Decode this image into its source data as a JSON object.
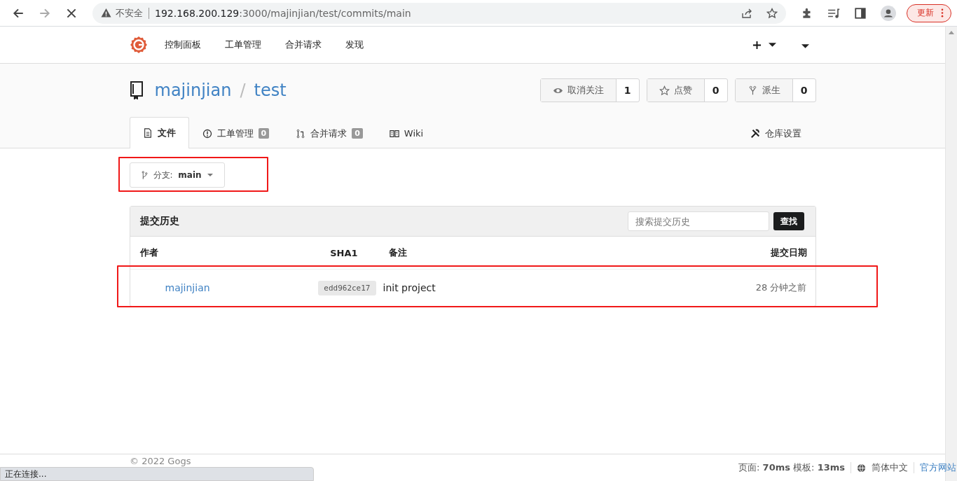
{
  "browser": {
    "security": "不安全",
    "url_host": "192.168.200.129",
    "url_path": ":3000/majinjian/test/commits/main",
    "update_button": "更新"
  },
  "nav": {
    "items": [
      "控制面板",
      "工单管理",
      "合并请求",
      "发现"
    ]
  },
  "repo": {
    "owner": "majinjian",
    "separator": "/",
    "name": "test",
    "actions": [
      {
        "label": "取消关注",
        "count": "1",
        "kind": "watch"
      },
      {
        "label": "点赞",
        "count": "0",
        "kind": "star"
      },
      {
        "label": "派生",
        "count": "0",
        "kind": "fork"
      }
    ]
  },
  "tabs": [
    {
      "label": "文件",
      "selected": true,
      "kind": "file"
    },
    {
      "label": "工单管理",
      "badge": "0",
      "selected": false,
      "kind": "issue"
    },
    {
      "label": "合并请求",
      "badge": "0",
      "selected": false,
      "kind": "pull"
    },
    {
      "label": "Wiki",
      "selected": false,
      "kind": "wiki"
    }
  ],
  "settings_tab": "仓库设置",
  "branch": {
    "label": "分支:",
    "value": "main"
  },
  "commits": {
    "title": "提交历史",
    "search_placeholder": "搜索提交历史",
    "search_button": "查找",
    "columns": [
      "作者",
      "SHA1",
      "备注",
      "提交日期"
    ],
    "rows": [
      {
        "author": "majinjian",
        "sha": "edd962ce17",
        "message": "init project",
        "date": "28 分钟之前"
      }
    ]
  },
  "footer": {
    "copyright": "© 2022 Gogs",
    "page_label": "页面:",
    "page_time": "70ms",
    "template_label": "模板:",
    "template_time": "13ms",
    "language": "简体中文",
    "website": "官方网站"
  },
  "status_bar": "正在连接..."
}
